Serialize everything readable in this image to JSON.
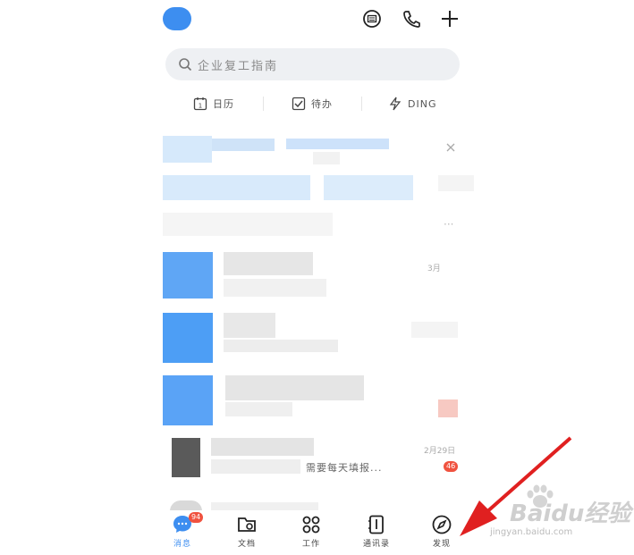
{
  "header": {
    "icons": [
      "chat-bubble-icon",
      "phone-icon",
      "plus-icon"
    ]
  },
  "search": {
    "placeholder": "企业复工指南"
  },
  "quick_actions": [
    {
      "label": "日历",
      "icon": "calendar-icon"
    },
    {
      "label": "待办",
      "icon": "checkbox-icon"
    },
    {
      "label": "DING",
      "icon": "lightning-icon"
    }
  ],
  "messages": {
    "row1": {
      "time": "3月"
    },
    "row4": {
      "time": "2月29日",
      "preview": "需要每天填报...",
      "badge": "46"
    }
  },
  "tabbar": {
    "tabs": [
      {
        "label": "消息",
        "icon": "message-icon",
        "badge": "94"
      },
      {
        "label": "文档",
        "icon": "document-icon"
      },
      {
        "label": "工作",
        "icon": "grid-icon"
      },
      {
        "label": "通讯录",
        "icon": "contacts-icon"
      },
      {
        "label": "发现",
        "icon": "compass-icon"
      }
    ]
  },
  "watermark": {
    "brand": "Baidu经验",
    "url": "jingyan.baidu.com"
  },
  "colors": {
    "accent": "#3d8ef0",
    "badge": "#f0523f",
    "arrow": "#e02020"
  }
}
